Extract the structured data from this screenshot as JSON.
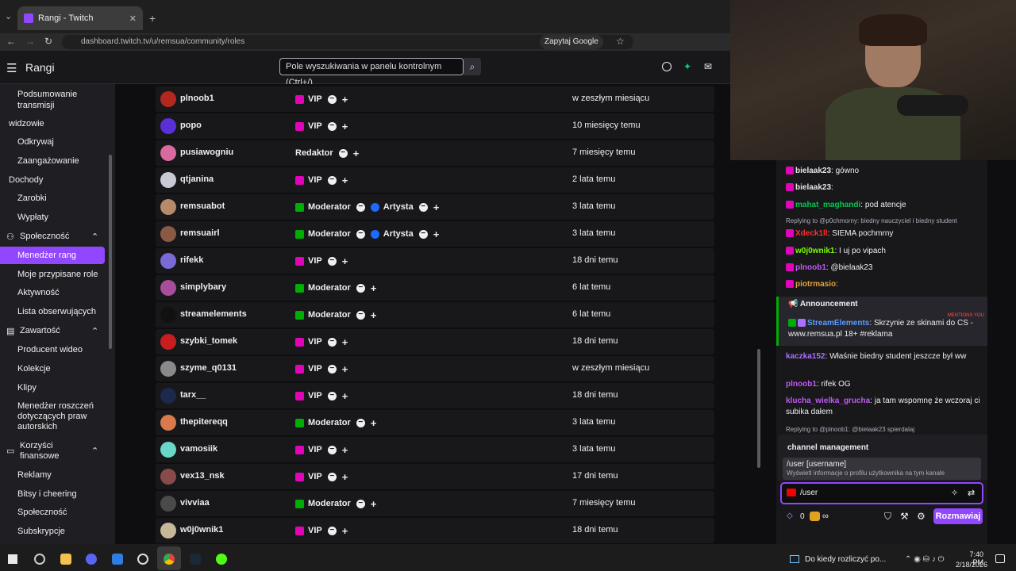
{
  "browser": {
    "tab_title": "Rangi - Twitch",
    "url": "dashboard.twitch.tv/u/remsua/community/roles",
    "google_btn": "Zapytaj Google"
  },
  "header": {
    "title": "Rangi",
    "search_placeholder": "Pole wyszukiwania w panelu kontrolnym (Ctrl+/)"
  },
  "sidebar": {
    "items": [
      "Podsumowanie transmisji",
      "widzowie",
      "Odkrywaj",
      "Zaangażowanie",
      "Dochody",
      "Zarobki",
      "Wypłaty",
      "Społeczność",
      "Menedżer rang",
      "Moje przypisane role",
      "Aktywność",
      "Lista obserwujących",
      "Zawartość",
      "Producent wideo",
      "Kolekcje",
      "Klipy",
      "Menedżer roszczeń dotyczących praw autorskich",
      "Korzyści finansowe",
      "Reklamy",
      "Bitsy i cheering",
      "Społeczność",
      "Subskrypcje"
    ]
  },
  "roles": {
    "vip": "VIP",
    "mod": "Moderator",
    "artist": "Artysta",
    "editor": "Redaktor",
    "rows": [
      {
        "user": "plnoob1",
        "roles": [
          "VIP"
        ],
        "since": "w zeszłym miesiącu",
        "color": "#b3281e"
      },
      {
        "user": "popo",
        "roles": [
          "VIP"
        ],
        "since": "10 miesięcy temu",
        "color": "#5a2fd8"
      },
      {
        "user": "pusiawogniu",
        "roles": [
          "Redaktor"
        ],
        "since": "7 miesięcy temu",
        "color": "#d86aa0"
      },
      {
        "user": "qtjanina",
        "roles": [
          "VIP"
        ],
        "since": "2 lata temu",
        "color": "#c9c9d6"
      },
      {
        "user": "remsuabot",
        "roles": [
          "Moderator",
          "Artysta"
        ],
        "since": "3 lata temu",
        "color": "#b68a6a"
      },
      {
        "user": "remsuairl",
        "roles": [
          "Moderator",
          "Artysta"
        ],
        "since": "3 lata temu",
        "color": "#8a5a44"
      },
      {
        "user": "rifekk",
        "roles": [
          "VIP"
        ],
        "since": "18 dni temu",
        "color": "#7a6ad8"
      },
      {
        "user": "simplybary",
        "roles": [
          "Moderator"
        ],
        "since": "6 lat temu",
        "color": "#a84d9a"
      },
      {
        "user": "streamelements",
        "roles": [
          "Moderator"
        ],
        "since": "6 lat temu",
        "color": "#111111"
      },
      {
        "user": "szybki_tomek",
        "roles": [
          "VIP"
        ],
        "since": "18 dni temu",
        "color": "#c81e1e"
      },
      {
        "user": "szyme_q0131",
        "roles": [
          "VIP"
        ],
        "since": "w zeszłym miesiącu",
        "color": "#8a8a8a"
      },
      {
        "user": "tarx__",
        "roles": [
          "VIP"
        ],
        "since": "18 dni temu",
        "color": "#1b2a4a"
      },
      {
        "user": "thepitereqq",
        "roles": [
          "Moderator"
        ],
        "since": "3 lata temu",
        "color": "#d87a4a"
      },
      {
        "user": "vamosiik",
        "roles": [
          "VIP"
        ],
        "since": "3 lata temu",
        "color": "#6ad8c8"
      },
      {
        "user": "vex13_nsk",
        "roles": [
          "VIP"
        ],
        "since": "17 dni temu",
        "color": "#8a4a4a"
      },
      {
        "user": "vivviaa",
        "roles": [
          "Moderator"
        ],
        "since": "7 miesięcy temu",
        "color": "#4a4a4a"
      },
      {
        "user": "w0j0wnik1",
        "roles": [
          "VIP"
        ],
        "since": "18 dni temu",
        "color": "#c8b89a"
      }
    ]
  },
  "chat": {
    "messages": [
      {
        "name": "bielaak23",
        "text": "gówno",
        "color": "#e6e6e6"
      },
      {
        "name": "bielaak23",
        "text": "",
        "color": "#e6e6e6"
      },
      {
        "name": "mahat_maghandi",
        "text": "pod atencje",
        "color": "#00c853"
      },
      {
        "reply": "Replying to @p0chmorny: biedny nauczyciel i biedny student"
      },
      {
        "name": "Xdeck1ll",
        "text": "SIEMA pochmrny",
        "color": "#ff2d2d"
      },
      {
        "name": "w0j0wnik1",
        "text": "I uj po vipach",
        "color": "#7cfc00"
      },
      {
        "name": "plnoob1",
        "text": "@bielaak23",
        "color": "#bf5af2"
      },
      {
        "name": "piotrmasio",
        "text": "",
        "color": "#e6a23c"
      }
    ],
    "announcement_title": "Announcement",
    "announcement_name": "StreamElements",
    "announcement_text": "Skrzynie ze skinami do CS - www.remsua.pl 18+ #reklama",
    "mentions": "MENTIONS YOU",
    "after": [
      {
        "name": "kaczka152",
        "text": "Właśnie biedny student jeszcze był ww",
        "color": "#a970ff"
      },
      {
        "name": "plnoob1",
        "text": "rifek OG",
        "color": "#bf5af2"
      },
      {
        "name": "klucha_wielka_grucha",
        "text": "ja tam wspomnę że wczoraj ci subika dałem",
        "color": "#bf5af2"
      }
    ],
    "reply2": "Replying to @plnoob1: @bielaak23 spierdalaj",
    "mgmt_title": "channel management",
    "cmd": "/user [username]",
    "cmd_desc": "Wyświetl informacje o profilu użytkownika na tym kanale",
    "input": "/user",
    "points": "0",
    "infinity": "∞",
    "send": "Rozmawiaj"
  },
  "taskbar": {
    "notification": "Do kiedy rozliczyć po...",
    "time": "7:40 PM",
    "date": "2/18/2026"
  }
}
